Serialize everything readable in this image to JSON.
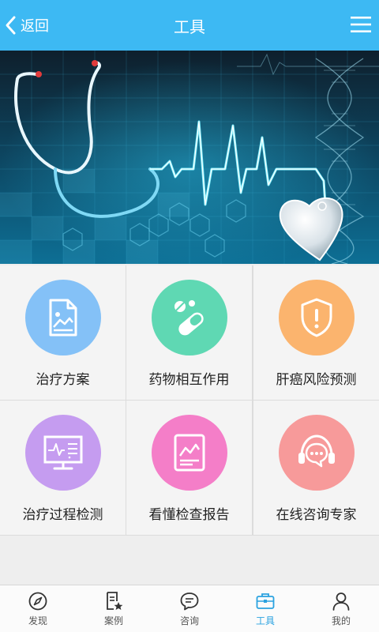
{
  "header": {
    "back_label": "返回",
    "title": "工具"
  },
  "tools": [
    {
      "label": "治疗方案",
      "color": "#84c1f7",
      "icon": "document-image-icon"
    },
    {
      "label": "药物相互作用",
      "color": "#5fd8b3",
      "icon": "pills-icon"
    },
    {
      "label": "肝癌风险预测",
      "color": "#fbb46e",
      "icon": "shield-warning-icon"
    },
    {
      "label": "治疗过程检测",
      "color": "#c59cf0",
      "icon": "monitor-ecg-icon"
    },
    {
      "label": "看懂检查报告",
      "color": "#f47ec8",
      "icon": "report-chart-icon"
    },
    {
      "label": "在线咨询专家",
      "color": "#f79a9a",
      "icon": "headset-chat-icon"
    }
  ],
  "tabs": [
    {
      "label": "发现",
      "icon": "compass-icon",
      "active": false
    },
    {
      "label": "案例",
      "icon": "case-star-icon",
      "active": false
    },
    {
      "label": "咨询",
      "icon": "chat-bubble-icon",
      "active": false
    },
    {
      "label": "工具",
      "icon": "toolbox-icon",
      "active": true
    },
    {
      "label": "我的",
      "icon": "person-icon",
      "active": false
    }
  ],
  "colors": {
    "accent": "#3db9f3",
    "tab_active": "#2aa2e0"
  }
}
